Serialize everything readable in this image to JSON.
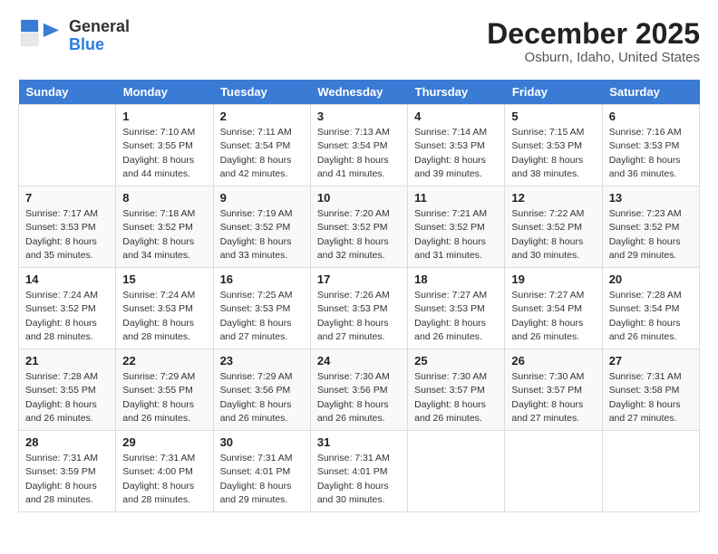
{
  "header": {
    "logo_general": "General",
    "logo_blue": "Blue",
    "month": "December 2025",
    "location": "Osburn, Idaho, United States"
  },
  "days_of_week": [
    "Sunday",
    "Monday",
    "Tuesday",
    "Wednesday",
    "Thursday",
    "Friday",
    "Saturday"
  ],
  "weeks": [
    [
      {
        "day": "",
        "info": ""
      },
      {
        "day": "1",
        "info": "Sunrise: 7:10 AM\nSunset: 3:55 PM\nDaylight: 8 hours\nand 44 minutes."
      },
      {
        "day": "2",
        "info": "Sunrise: 7:11 AM\nSunset: 3:54 PM\nDaylight: 8 hours\nand 42 minutes."
      },
      {
        "day": "3",
        "info": "Sunrise: 7:13 AM\nSunset: 3:54 PM\nDaylight: 8 hours\nand 41 minutes."
      },
      {
        "day": "4",
        "info": "Sunrise: 7:14 AM\nSunset: 3:53 PM\nDaylight: 8 hours\nand 39 minutes."
      },
      {
        "day": "5",
        "info": "Sunrise: 7:15 AM\nSunset: 3:53 PM\nDaylight: 8 hours\nand 38 minutes."
      },
      {
        "day": "6",
        "info": "Sunrise: 7:16 AM\nSunset: 3:53 PM\nDaylight: 8 hours\nand 36 minutes."
      }
    ],
    [
      {
        "day": "7",
        "info": "Sunrise: 7:17 AM\nSunset: 3:53 PM\nDaylight: 8 hours\nand 35 minutes."
      },
      {
        "day": "8",
        "info": "Sunrise: 7:18 AM\nSunset: 3:52 PM\nDaylight: 8 hours\nand 34 minutes."
      },
      {
        "day": "9",
        "info": "Sunrise: 7:19 AM\nSunset: 3:52 PM\nDaylight: 8 hours\nand 33 minutes."
      },
      {
        "day": "10",
        "info": "Sunrise: 7:20 AM\nSunset: 3:52 PM\nDaylight: 8 hours\nand 32 minutes."
      },
      {
        "day": "11",
        "info": "Sunrise: 7:21 AM\nSunset: 3:52 PM\nDaylight: 8 hours\nand 31 minutes."
      },
      {
        "day": "12",
        "info": "Sunrise: 7:22 AM\nSunset: 3:52 PM\nDaylight: 8 hours\nand 30 minutes."
      },
      {
        "day": "13",
        "info": "Sunrise: 7:23 AM\nSunset: 3:52 PM\nDaylight: 8 hours\nand 29 minutes."
      }
    ],
    [
      {
        "day": "14",
        "info": "Sunrise: 7:24 AM\nSunset: 3:52 PM\nDaylight: 8 hours\nand 28 minutes."
      },
      {
        "day": "15",
        "info": "Sunrise: 7:24 AM\nSunset: 3:53 PM\nDaylight: 8 hours\nand 28 minutes."
      },
      {
        "day": "16",
        "info": "Sunrise: 7:25 AM\nSunset: 3:53 PM\nDaylight: 8 hours\nand 27 minutes."
      },
      {
        "day": "17",
        "info": "Sunrise: 7:26 AM\nSunset: 3:53 PM\nDaylight: 8 hours\nand 27 minutes."
      },
      {
        "day": "18",
        "info": "Sunrise: 7:27 AM\nSunset: 3:53 PM\nDaylight: 8 hours\nand 26 minutes."
      },
      {
        "day": "19",
        "info": "Sunrise: 7:27 AM\nSunset: 3:54 PM\nDaylight: 8 hours\nand 26 minutes."
      },
      {
        "day": "20",
        "info": "Sunrise: 7:28 AM\nSunset: 3:54 PM\nDaylight: 8 hours\nand 26 minutes."
      }
    ],
    [
      {
        "day": "21",
        "info": "Sunrise: 7:28 AM\nSunset: 3:55 PM\nDaylight: 8 hours\nand 26 minutes."
      },
      {
        "day": "22",
        "info": "Sunrise: 7:29 AM\nSunset: 3:55 PM\nDaylight: 8 hours\nand 26 minutes."
      },
      {
        "day": "23",
        "info": "Sunrise: 7:29 AM\nSunset: 3:56 PM\nDaylight: 8 hours\nand 26 minutes."
      },
      {
        "day": "24",
        "info": "Sunrise: 7:30 AM\nSunset: 3:56 PM\nDaylight: 8 hours\nand 26 minutes."
      },
      {
        "day": "25",
        "info": "Sunrise: 7:30 AM\nSunset: 3:57 PM\nDaylight: 8 hours\nand 26 minutes."
      },
      {
        "day": "26",
        "info": "Sunrise: 7:30 AM\nSunset: 3:57 PM\nDaylight: 8 hours\nand 27 minutes."
      },
      {
        "day": "27",
        "info": "Sunrise: 7:31 AM\nSunset: 3:58 PM\nDaylight: 8 hours\nand 27 minutes."
      }
    ],
    [
      {
        "day": "28",
        "info": "Sunrise: 7:31 AM\nSunset: 3:59 PM\nDaylight: 8 hours\nand 28 minutes."
      },
      {
        "day": "29",
        "info": "Sunrise: 7:31 AM\nSunset: 4:00 PM\nDaylight: 8 hours\nand 28 minutes."
      },
      {
        "day": "30",
        "info": "Sunrise: 7:31 AM\nSunset: 4:01 PM\nDaylight: 8 hours\nand 29 minutes."
      },
      {
        "day": "31",
        "info": "Sunrise: 7:31 AM\nSunset: 4:01 PM\nDaylight: 8 hours\nand 30 minutes."
      },
      {
        "day": "",
        "info": ""
      },
      {
        "day": "",
        "info": ""
      },
      {
        "day": "",
        "info": ""
      }
    ]
  ]
}
